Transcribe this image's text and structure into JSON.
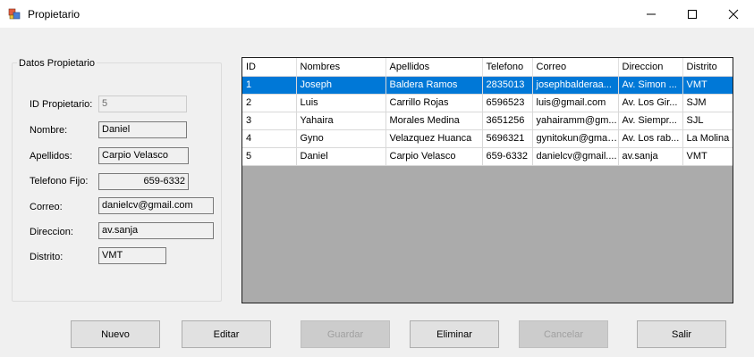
{
  "window": {
    "title": "Propietario"
  },
  "group": {
    "legend": "Datos Propietario",
    "fields": [
      {
        "label": "ID Propietario:",
        "value": "5",
        "disabled": true
      },
      {
        "label": "Nombre:",
        "value": "Daniel"
      },
      {
        "label": "Apellidos:",
        "value": "Carpio Velasco"
      },
      {
        "label": "Telefono Fijo:",
        "value": "659-6332"
      },
      {
        "label": "Correo:",
        "value": "danielcv@gmail.com"
      },
      {
        "label": "Direccion:",
        "value": "av.sanja"
      },
      {
        "label": "Distrito:",
        "value": "VMT"
      }
    ]
  },
  "grid": {
    "columns": [
      "ID",
      "Nombres",
      "Apellidos",
      "Telefono",
      "Correo",
      "Direccion",
      "Distrito"
    ],
    "rows": [
      [
        "1",
        "Joseph",
        "Baldera Ramos",
        "2835013",
        "josephbalderaa...",
        "Av. Simon ...",
        "VMT"
      ],
      [
        "2",
        "Luis",
        "Carrillo Rojas",
        "6596523",
        "luis@gmail.com",
        "Av. Los Gir...",
        "SJM"
      ],
      [
        "3",
        "Yahaira",
        "Morales Medina",
        "3651256",
        "yahairamm@gm...",
        "Av. Siempr...",
        "SJL"
      ],
      [
        "4",
        "Gyno",
        "Velazquez Huanca",
        "5696321",
        "gynitokun@gmai...",
        "Av. Los rab...",
        "La Molina"
      ],
      [
        "5",
        "Daniel",
        "Carpio Velasco",
        "659-6332",
        "danielcv@gmail....",
        "av.sanja",
        "VMT"
      ]
    ],
    "selected_row": 0
  },
  "buttons": {
    "nuevo": "Nuevo",
    "editar": "Editar",
    "guardar": "Guardar",
    "eliminar": "Eliminar",
    "cancelar": "Cancelar",
    "salir": "Salir"
  }
}
